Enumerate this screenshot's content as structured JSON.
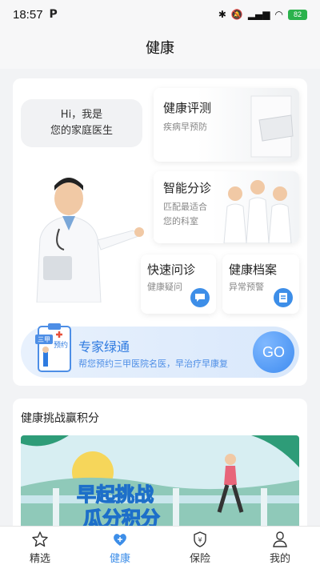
{
  "status_bar": {
    "time": "18:57",
    "battery": "82"
  },
  "header": {
    "title": "健康"
  },
  "assistant": {
    "line1": "Hi，我是",
    "line2": "您的家庭医生"
  },
  "features": [
    {
      "title": "健康评测",
      "subtitle": "疾病早预防"
    },
    {
      "title": "智能分诊",
      "subtitle1": "匹配最适合",
      "subtitle2": "您的科室"
    },
    {
      "title": "快速问诊",
      "subtitle": "健康疑问"
    },
    {
      "title": "健康档案",
      "subtitle": "异常预警"
    }
  ],
  "expert_banner": {
    "title": "专家绿通",
    "subtitle": "帮您预约三甲医院名医，早治疗早康复",
    "badge": "三甲",
    "badge2": "预约",
    "go_label": "GO"
  },
  "challenge": {
    "title": "健康挑战赢积分",
    "image_line1": "早起挑战",
    "image_line2": "瓜分积分"
  },
  "tabbar": [
    {
      "label": "精选",
      "icon": "star-icon"
    },
    {
      "label": "健康",
      "icon": "heart-plus-icon",
      "active": true
    },
    {
      "label": "保险",
      "icon": "shield-icon"
    },
    {
      "label": "我的",
      "icon": "user-icon"
    }
  ],
  "colors": {
    "accent": "#3d8ee8",
    "background": "#f2f3f5"
  }
}
